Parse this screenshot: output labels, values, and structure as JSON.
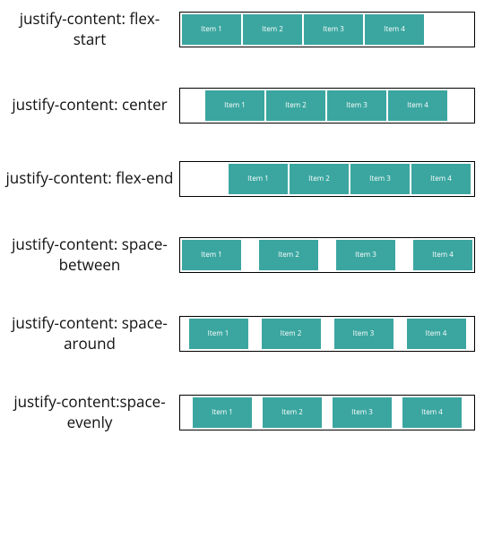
{
  "item_labels": [
    "Item 1",
    "Item 2",
    "Item 3",
    "Item 4"
  ],
  "colors": {
    "item_bg": "#3ba6a0",
    "item_fg": "#ffffff",
    "container_border": "#000000"
  },
  "examples": [
    {
      "key": "flex-start",
      "label": "justify-content: flex-start",
      "css_class": "c-flex-start"
    },
    {
      "key": "center",
      "label": "justify-content: center",
      "css_class": "c-center"
    },
    {
      "key": "flex-end",
      "label": "justify-content: flex-end",
      "css_class": "c-flex-end"
    },
    {
      "key": "space-between",
      "label": "justify-content: space-between",
      "css_class": "c-space-between"
    },
    {
      "key": "space-around",
      "label": "justify-content: space-around",
      "css_class": "c-space-around"
    },
    {
      "key": "space-evenly",
      "label": "justify-content:space-evenly",
      "css_class": "c-space-evenly"
    }
  ]
}
